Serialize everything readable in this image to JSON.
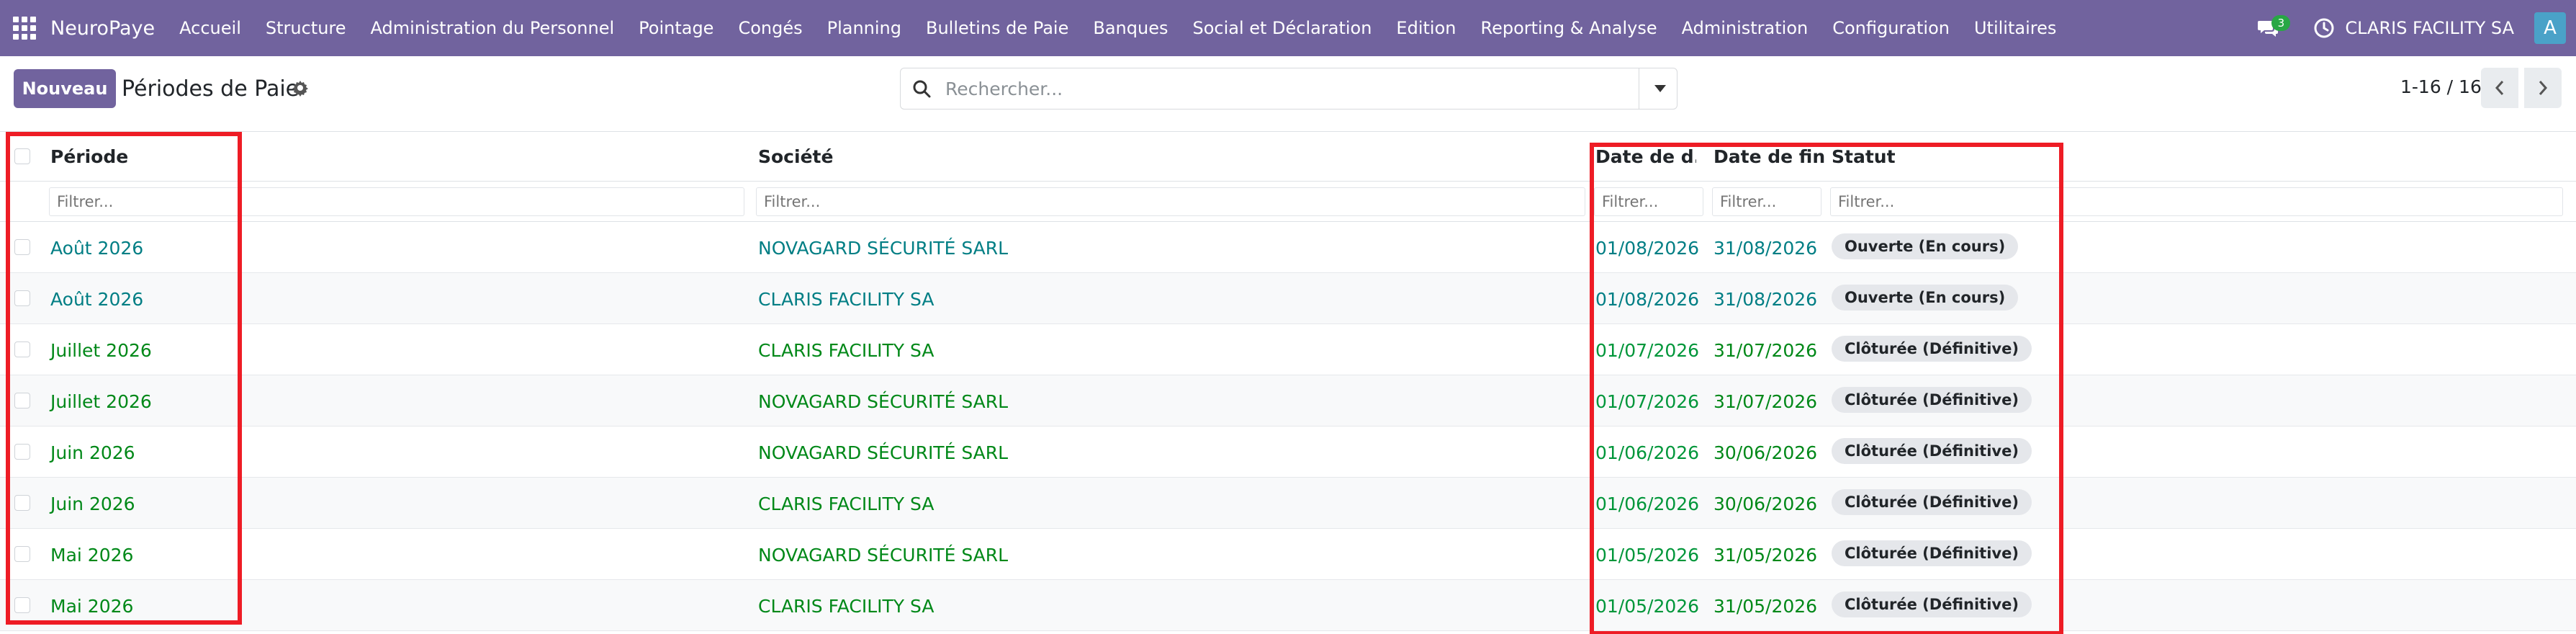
{
  "navbar": {
    "brand": "NeuroPaye",
    "menu": [
      "Accueil",
      "Structure",
      "Administration du Personnel",
      "Pointage",
      "Congés",
      "Planning",
      "Bulletins de Paie",
      "Banques",
      "Social et Déclaration",
      "Edition",
      "Reporting & Analyse",
      "Administration",
      "Configuration",
      "Utilitaires"
    ],
    "chat_count": "3",
    "company": "CLARIS FACILITY SA",
    "avatar_letter": "A",
    "icons": [
      "apps-icon",
      "chat-icon",
      "clock-icon"
    ]
  },
  "control": {
    "new_button": "Nouveau",
    "title": "Périodes de Paie",
    "search_placeholder": "Rechercher...",
    "pager": "1-16 / 16",
    "icons": [
      "gear-icon",
      "search-icon",
      "caret-down-icon",
      "chevron-left-icon",
      "chevron-right-icon"
    ]
  },
  "table": {
    "headers": {
      "period": "Période",
      "company": "Société",
      "date_start": "Date de d...",
      "date_end": "Date de fin",
      "status": "Statut"
    },
    "filter_placeholder": "Filtrer...",
    "rows": [
      {
        "period": "Août 2026",
        "company": "NOVAGARD SÉCURITÉ SARL",
        "date_start": "01/08/2026",
        "date_end": "31/08/2026",
        "status": "Ouverte (En cours)",
        "state": "open"
      },
      {
        "period": "Août 2026",
        "company": "CLARIS FACILITY SA",
        "date_start": "01/08/2026",
        "date_end": "31/08/2026",
        "status": "Ouverte (En cours)",
        "state": "open"
      },
      {
        "period": "Juillet 2026",
        "company": "CLARIS FACILITY SA",
        "date_start": "01/07/2026",
        "date_end": "31/07/2026",
        "status": "Clôturée (Définitive)",
        "state": "closed"
      },
      {
        "period": "Juillet 2026",
        "company": "NOVAGARD SÉCURITÉ SARL",
        "date_start": "01/07/2026",
        "date_end": "31/07/2026",
        "status": "Clôturée (Définitive)",
        "state": "closed"
      },
      {
        "period": "Juin 2026",
        "company": "NOVAGARD SÉCURITÉ SARL",
        "date_start": "01/06/2026",
        "date_end": "30/06/2026",
        "status": "Clôturée (Définitive)",
        "state": "closed"
      },
      {
        "period": "Juin 2026",
        "company": "CLARIS FACILITY SA",
        "date_start": "01/06/2026",
        "date_end": "30/06/2026",
        "status": "Clôturée (Définitive)",
        "state": "closed"
      },
      {
        "period": "Mai 2026",
        "company": "NOVAGARD SÉCURITÉ SARL",
        "date_start": "01/05/2026",
        "date_end": "31/05/2026",
        "status": "Clôturée (Définitive)",
        "state": "closed"
      },
      {
        "period": "Mai 2026",
        "company": "CLARIS FACILITY SA",
        "date_start": "01/05/2026",
        "date_end": "31/05/2026",
        "status": "Clôturée (Définitive)",
        "state": "closed"
      }
    ]
  },
  "colors": {
    "navbar": "#71639e",
    "open_text": "#017e84",
    "closed_text": "#008818",
    "date_start_text": "#00963a",
    "highlight": "#ee1c25"
  }
}
